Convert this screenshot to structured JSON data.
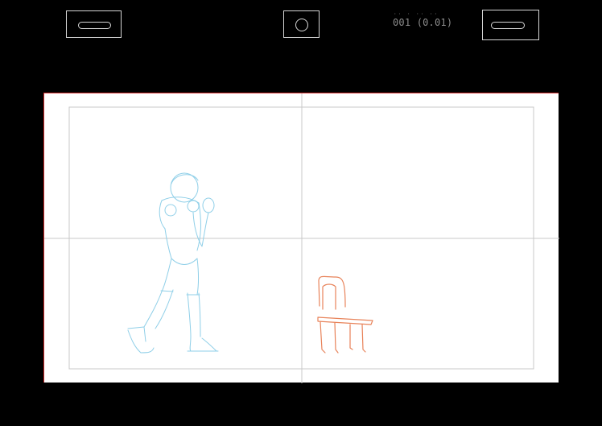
{
  "toolbar": {
    "left_button": {
      "icon": "slot-icon"
    },
    "center_button": {
      "icon": "circle-icon"
    },
    "right_button": {
      "icon": "slot-icon"
    }
  },
  "frame_counter": {
    "text": "001 (0.01)",
    "dots": "·· · ·· ··"
  },
  "canvas": {
    "paper_color": "#ffffff",
    "border_color": "#d02a2a",
    "guide_color": "#c8c8c8",
    "sketches": [
      {
        "name": "figure-sketch",
        "color": "#8fcfe8"
      },
      {
        "name": "chair-sketch",
        "color": "#e8835a"
      }
    ]
  }
}
